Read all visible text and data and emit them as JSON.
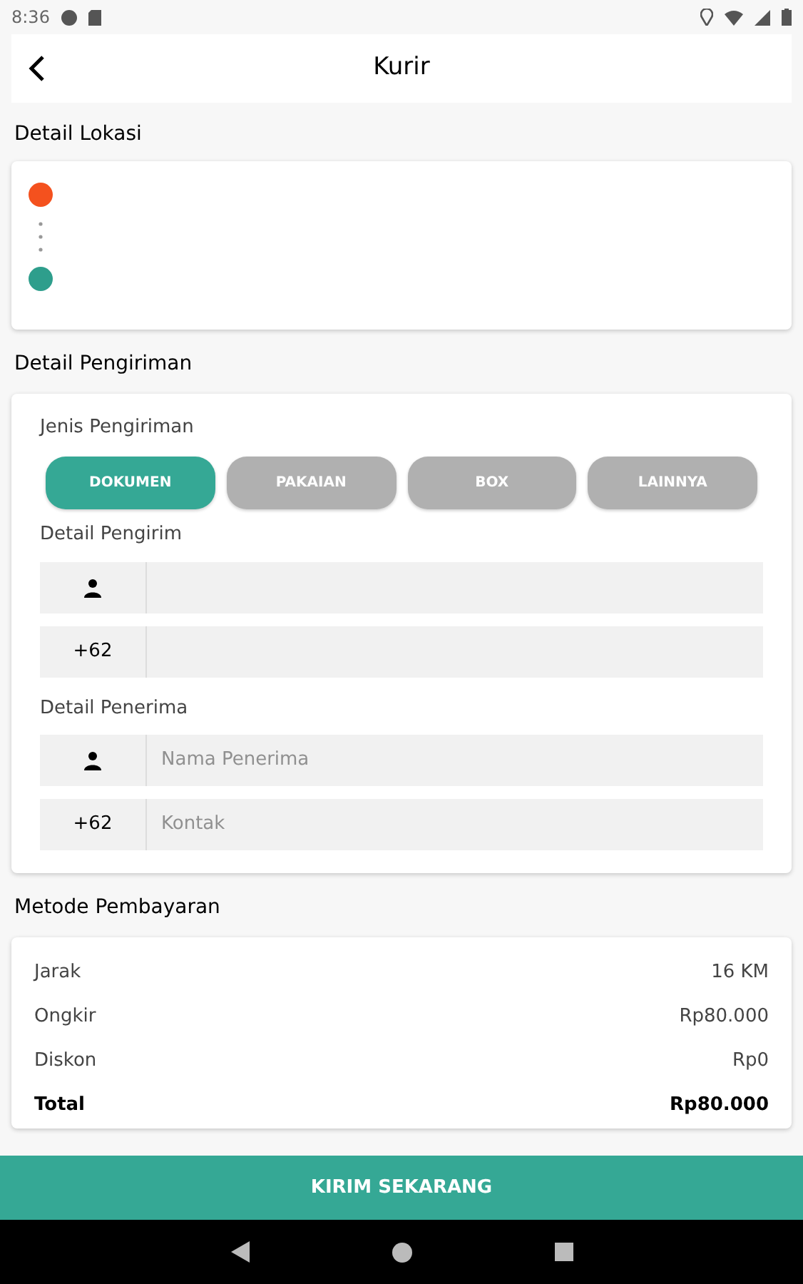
{
  "status_bar": {
    "time": "8:36"
  },
  "header": {
    "title": "Kurir"
  },
  "location": {
    "title": "Detail Lokasi",
    "points": [
      {
        "color": "#f4511e"
      },
      {
        "color": "#2e9e8c"
      }
    ]
  },
  "shipping": {
    "title": "Detail Pengiriman",
    "type_label": "Jenis Pengiriman",
    "types": [
      {
        "label": "DOKUMEN",
        "selected": true
      },
      {
        "label": "PAKAIAN",
        "selected": false
      },
      {
        "label": "BOX",
        "selected": false
      },
      {
        "label": "LAINNYA",
        "selected": false
      }
    ],
    "sender": {
      "label": "Detail Pengirim",
      "phone_prefix": "+62"
    },
    "receiver": {
      "label": "Detail Penerima",
      "name_placeholder": "Nama Penerima",
      "phone_prefix": "+62",
      "phone_placeholder": "Kontak"
    }
  },
  "payment": {
    "title": "Metode Pembayaran",
    "rows": [
      {
        "label": "Jarak",
        "value": "16 KM",
        "bold": false
      },
      {
        "label": "Ongkir",
        "value": "Rp80.000",
        "bold": false
      },
      {
        "label": "Diskon",
        "value": "Rp0",
        "bold": false
      },
      {
        "label": "Total",
        "value": "Rp80.000",
        "bold": true
      }
    ]
  },
  "submit": {
    "label": "KIRIM SEKARANG"
  }
}
